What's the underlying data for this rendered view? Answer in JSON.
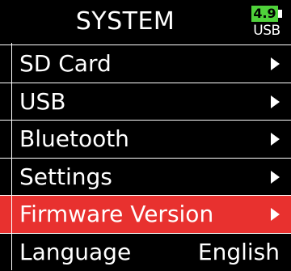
{
  "header": {
    "title": "SYSTEM",
    "battery_level": "4.9",
    "power_source": "USB",
    "battery_color": "#4fd13a"
  },
  "menu": {
    "accent_color": "#e8312f",
    "items": [
      {
        "label": "SD Card",
        "icon": "chevron-right-icon"
      },
      {
        "label": "USB",
        "icon": "chevron-right-icon"
      },
      {
        "label": "Bluetooth",
        "icon": "chevron-right-icon"
      },
      {
        "label": "Settings",
        "icon": "chevron-right-icon"
      },
      {
        "label": "Firmware Version",
        "icon": "chevron-right-icon",
        "selected": true
      },
      {
        "label": "Language",
        "value": "English"
      }
    ]
  }
}
